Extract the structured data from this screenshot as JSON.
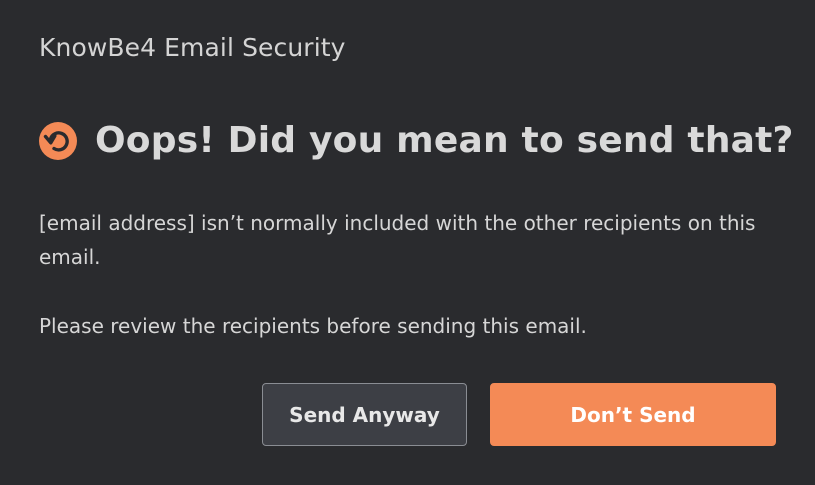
{
  "app": {
    "title": "KnowBe4 Email Security"
  },
  "dialog": {
    "icon": "undo-circle-icon",
    "heading": "Oops! Did you mean to send that?",
    "message": "[email address] isn’t normally included with the other recipients on this email.",
    "review_text": "Please review the recipients before sending this email."
  },
  "actions": {
    "send_anyway_label": "Send Anyway",
    "dont_send_label": "Don’t Send"
  },
  "colors": {
    "background": "#2a2b2e",
    "accent": "#f48a56",
    "secondary_button": "#3d3f45",
    "text": "#d6d6d6"
  }
}
